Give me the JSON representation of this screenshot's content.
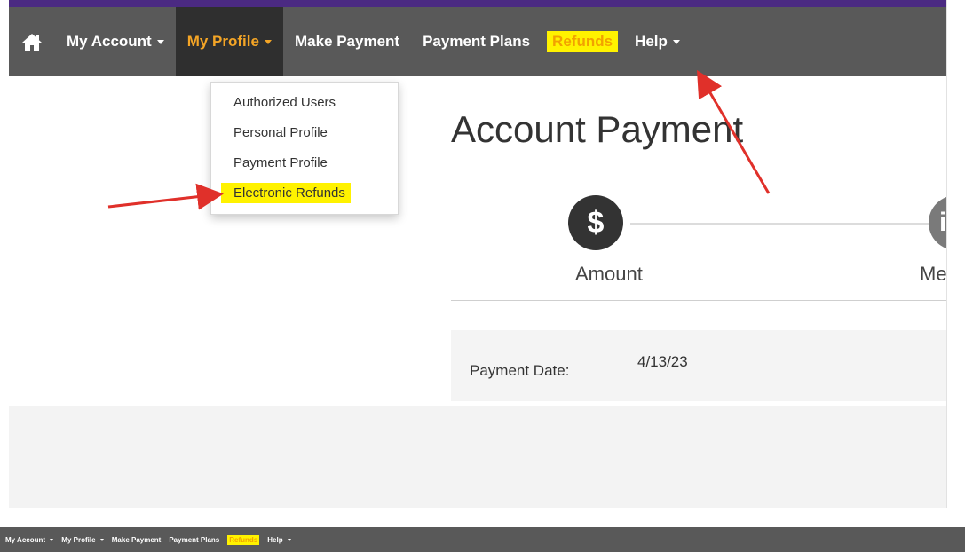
{
  "nav": {
    "items": [
      {
        "label": "My Account",
        "dropdown": true
      },
      {
        "label": "My Profile",
        "dropdown": true,
        "active": true
      },
      {
        "label": "Make Payment",
        "dropdown": false
      },
      {
        "label": "Payment Plans",
        "dropdown": false
      },
      {
        "label": "Refunds",
        "dropdown": false,
        "highlighted": true
      },
      {
        "label": "Help",
        "dropdown": true
      }
    ]
  },
  "profile_menu": {
    "items": [
      {
        "label": "Authorized Users"
      },
      {
        "label": "Personal Profile"
      },
      {
        "label": "Payment Profile"
      },
      {
        "label": "Electronic Refunds",
        "highlighted": true
      }
    ]
  },
  "page": {
    "title": "Account Payment",
    "steps": [
      {
        "icon": "$",
        "label": "Amount"
      },
      {
        "icon": "i",
        "label": "Me"
      }
    ],
    "payment_date_label": "Payment Date:",
    "payment_date_value": "4/13/23"
  },
  "colors": {
    "nav_bg": "#595959",
    "brand_purple": "#4b2a82",
    "active_text": "#f4a526",
    "highlight": "#fff200",
    "annotation_arrow": "#e0302a"
  },
  "icons": [
    "home-icon",
    "dollar-icon",
    "info-icon"
  ]
}
